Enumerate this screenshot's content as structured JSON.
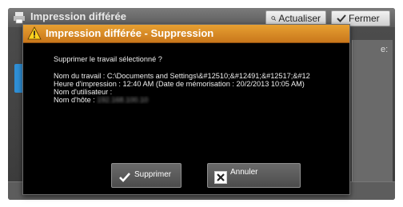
{
  "background_window": {
    "title": "Impression différée",
    "update_button_label": "Actualiser",
    "close_button_label": "Fermer",
    "right_panel_text": "e:"
  },
  "dialog": {
    "title": "Impression différée - Suppression",
    "header_color": "#d98a25",
    "question": "Supprimer le travail sélectionné ?",
    "details": [
      "Nom du travail : C:\\Documents and Settings\\&#12510;&#12491;&#12517;&#12",
      "Heure d'impression : 12:40 AM (Date de mémorisation : 20/2/2013 10:05 AM)",
      "Nom d'utilisateur :"
    ],
    "host_label": "Nom d'hôte :",
    "host_value": "192.168.100.10",
    "confirm_button_label": "Supprimer",
    "cancel_button_label": "Annuler"
  },
  "icons": {
    "title_icon": "printer-icon",
    "warning": "warning-icon",
    "confirm": "checkmark-icon",
    "cancel": "close-x-icon",
    "update": "refresh-icon",
    "close": "checkmark-icon"
  }
}
